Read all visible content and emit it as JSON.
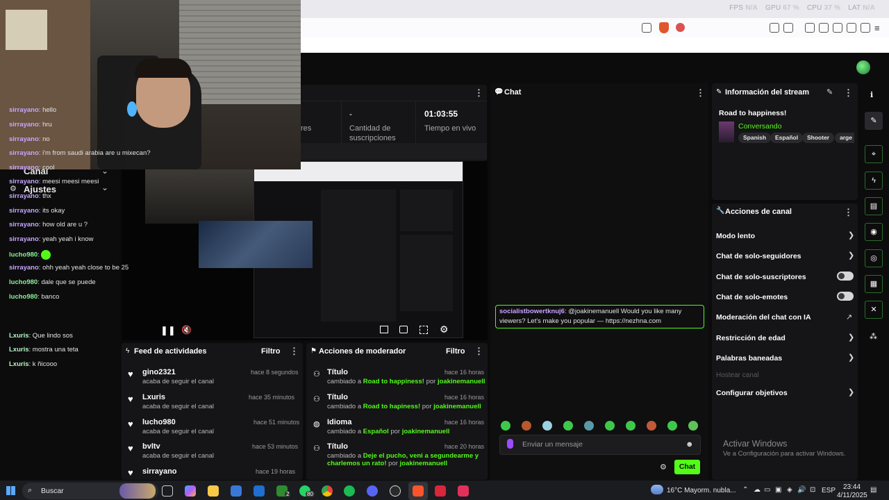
{
  "browser": {
    "perf": {
      "fps_label": "FPS",
      "fps_value": "N/A",
      "gpu_label": "GPU",
      "gpu_value": "67 %",
      "cpu_label": "CPU",
      "cpu_value": "37 %",
      "lat_label": "LAT",
      "lat_value": "N/A"
    }
  },
  "sidebar": {
    "items": [
      {
        "label": "Canal"
      },
      {
        "label": "Ajustes"
      }
    ]
  },
  "stats": {
    "partial_label": "res",
    "subs_value": "-",
    "subs_label": "Cantidad de suscripciones",
    "live_value": "01:03:55",
    "live_label": "Tiempo en vivo"
  },
  "feed": {
    "title": "Feed de actividades",
    "filter": "Filtro",
    "items": [
      {
        "name": "gino2321",
        "desc": "acaba de seguir el canal",
        "time": "hace 8 segundos"
      },
      {
        "name": "Lxuris",
        "desc": "acaba de seguir el canal",
        "time": "hace 35 minutos"
      },
      {
        "name": "lucho980",
        "desc": "acaba de seguir el canal",
        "time": "hace 51 minutos"
      },
      {
        "name": "bvltv",
        "desc": "acaba de seguir el canal",
        "time": "hace 53 minutos"
      },
      {
        "name": "sirrayano",
        "desc": "",
        "time": "hace 19 horas"
      }
    ]
  },
  "mod": {
    "title": "Acciones de moderador",
    "filter": "Filtro",
    "items": [
      {
        "name": "Título",
        "pre": "cambiado a",
        "val": "Road to happiness!",
        "by": "por",
        "user": "joakinemanuell",
        "time": "hace 16 horas"
      },
      {
        "name": "Título",
        "pre": "cambiado a",
        "val": "Road to hapiness!",
        "by": "por",
        "user": "joakinemanuell",
        "time": "hace 16 horas"
      },
      {
        "name": "Idioma",
        "pre": "cambiado a",
        "val": "Español",
        "by": "por",
        "user": "joakinemanuell",
        "time": "hace 16 horas"
      },
      {
        "name": "Título",
        "pre": "cambiado a",
        "val": "Deje el pucho, veni a segundearme y",
        "val2": "charlemos un rato!",
        "by": "por",
        "user": "joakinemanuell",
        "time": "hace 20 horas"
      }
    ]
  },
  "chat": {
    "title": "Chat",
    "messages": [
      {
        "user": "sirrayano",
        "text": "hello"
      },
      {
        "user": "sirrayano",
        "text": "hru"
      },
      {
        "user": "sirrayano",
        "text": "no"
      },
      {
        "user": "sirrayano",
        "text": "i'm from saudi arabia are u mixecan?"
      },
      {
        "user": "sirrayano",
        "text": "cool"
      },
      {
        "user": "sirrayano",
        "text": "meesi meesi meesi"
      },
      {
        "user": "sirrayano",
        "text": "thx"
      },
      {
        "user": "sirrayano",
        "text": "its okay"
      },
      {
        "user": "sirrayano",
        "text": "how old are u ?"
      },
      {
        "user": "sirrayano",
        "text": "yeah yeah i know"
      },
      {
        "user": "lucho980",
        "text": ""
      },
      {
        "user": "sirrayano",
        "text": "ohh yeah yeah close to be 25"
      },
      {
        "user": "lucho980",
        "text": "dale que se puede"
      },
      {
        "user": "lucho980",
        "text": "banco"
      },
      {
        "user": "socialistbowertknuj6",
        "text": "@joakinemanuell Would you like many",
        "text2": "viewers? Let's make you popular — https://nezhna.com"
      },
      {
        "user": "Lxuris",
        "text": "Que lindo sos"
      },
      {
        "user": "Lxuris",
        "text": "mostra una teta"
      },
      {
        "user": "Lxuris",
        "text": "k ñicooo"
      }
    ],
    "input_placeholder": "Enviar un mensaje",
    "send_label": "Chat"
  },
  "stream_info": {
    "title": "Información del stream",
    "stream_title": "Road to happiness!",
    "category": "Conversando",
    "tags": [
      "Spanish",
      "Español",
      "Shooter",
      "arge"
    ]
  },
  "channel_actions": {
    "title": "Acciones de canal",
    "items": [
      {
        "label": "Modo lento"
      },
      {
        "label": "Chat de solo-seguidores"
      },
      {
        "label": "Chat de solo-suscriptores"
      },
      {
        "label": "Chat de solo-emotes"
      },
      {
        "label": "Moderación del chat con IA"
      },
      {
        "label": "Restricción de edad"
      },
      {
        "label": "Palabras baneadas"
      },
      {
        "label": "Hostear canal"
      },
      {
        "label": "Configurar objetivos"
      }
    ]
  },
  "windows": {
    "activate": "Activar Windows",
    "activate_sub": "Ve a Configuración para activar Windows."
  },
  "taskbar": {
    "search": "Buscar",
    "weather": "16°C  Mayorm. nubla...",
    "lang": "ESP",
    "time": "23:44",
    "date": "4/11/2025",
    "badge_xbox": "2",
    "badge_whatsapp": "80"
  },
  "colors": {
    "accent": "#53fc18",
    "chat_purple": "#c6a6ff",
    "chat_green": "#8ef29b"
  }
}
